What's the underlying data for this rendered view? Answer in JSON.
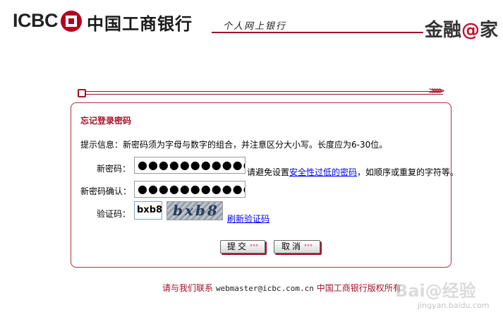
{
  "header": {
    "logo_text": "ICBC",
    "bank_name": "中国工商银行",
    "slogan": "个人网上银行",
    "brand_prefix": "金融",
    "brand_at": "@",
    "brand_suffix": "家"
  },
  "form": {
    "title": "忘记登录密码",
    "hint": "提示信息：新密码须为字母与数字的组合，并注意区分大小写。长度应为6-30位。",
    "new_password_label": "新密码：",
    "new_password_value": "●●●●●●●●●●●",
    "confirm_label": "新密码确认：",
    "confirm_value": "●●●●●●●●●●●",
    "warn_prefix": "请避免设置",
    "warn_link": "安全性过低的密码",
    "warn_suffix": "，如顺序或重复的字符等。",
    "captcha_label": "验证码：",
    "captcha_value": "bxb8",
    "captcha_image_text": "bxb8",
    "refresh_link": "刷新验证码",
    "submit_label": "提交",
    "cancel_label": "取消"
  },
  "footer": {
    "contact": "请与我们联系",
    "email": "webmaster@icbc.com.cn",
    "copyright": "中国工商银行版权所有"
  },
  "watermark": {
    "text": "Bai@经验",
    "url": "jingyan.baidu.com"
  },
  "colors": {
    "brand_red": "#a3112a",
    "link_blue": "#0000ff"
  }
}
